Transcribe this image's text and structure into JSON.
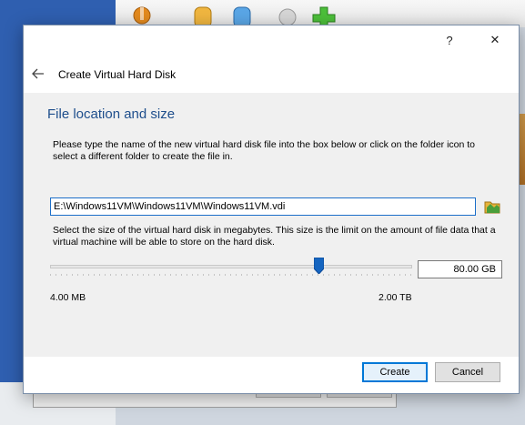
{
  "dialog": {
    "help_label": "?",
    "close_label": "✕",
    "wizard_title": "Create Virtual Hard Disk",
    "section_title": "File location and size",
    "location_description": "Please type the name of the new virtual hard disk file into the box below or click on the folder icon to select a different folder to create the file in.",
    "file_path": "E:\\Windows11VM\\Windows11VM\\Windows11VM.vdi",
    "size_description": "Select the size of the virtual hard disk in megabytes. This size is the limit on the amount of file data that a virtual machine will be able to store on the hard disk.",
    "size_value": "80.00 GB",
    "slider_min_label": "4.00 MB",
    "slider_max_label": "2.00 TB",
    "slider_position": 0.74,
    "create_label": "Create",
    "cancel_label": "Cancel"
  },
  "icons": {
    "back": "back-arrow-icon",
    "folder": "folder-browse-icon",
    "help": "help-icon",
    "close": "close-icon"
  },
  "colors": {
    "section_title": "#1e4e8c",
    "input_focus_border": "#1c6fc9",
    "slider_thumb": "#1565c0",
    "default_button_border": "#0078d7"
  }
}
